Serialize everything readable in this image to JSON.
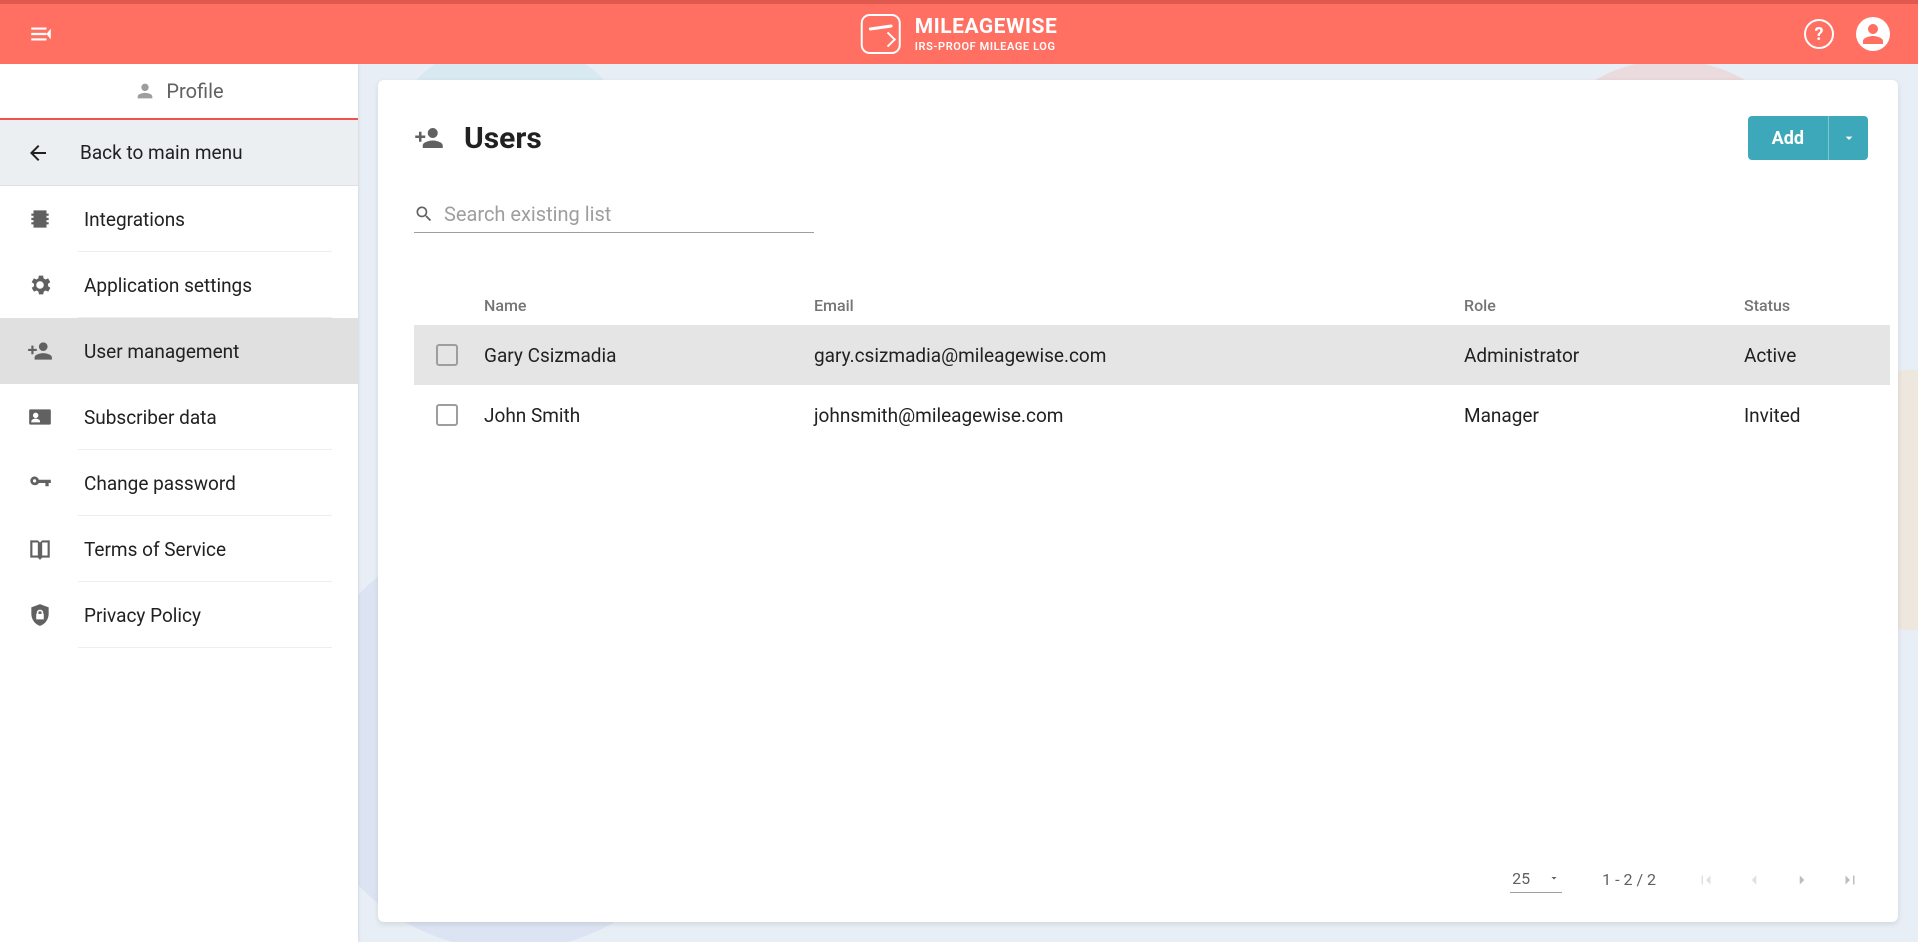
{
  "brand": {
    "title": "MILEAGEWISE",
    "subtitle": "IRS-PROOF MILEAGE LOG"
  },
  "sidebar": {
    "header": "Profile",
    "back": "Back to main menu",
    "items": [
      {
        "label": "Integrations"
      },
      {
        "label": "Application settings"
      },
      {
        "label": "User management"
      },
      {
        "label": "Subscriber data"
      },
      {
        "label": "Change password"
      },
      {
        "label": "Terms of Service"
      },
      {
        "label": "Privacy Policy"
      }
    ]
  },
  "page": {
    "title": "Users",
    "add_label": "Add",
    "search_placeholder": "Search existing list"
  },
  "table": {
    "headers": {
      "name": "Name",
      "email": "Email",
      "role": "Role",
      "status": "Status"
    },
    "rows": [
      {
        "name": "Gary Csizmadia",
        "email": "gary.csizmadia@mileagewise.com",
        "role": "Administrator",
        "status": "Active"
      },
      {
        "name": "John Smith",
        "email": "johnsmith@mileagewise.com",
        "role": "Manager",
        "status": "Invited"
      }
    ]
  },
  "pager": {
    "page_size": "25",
    "range": "1 - 2 / 2"
  }
}
